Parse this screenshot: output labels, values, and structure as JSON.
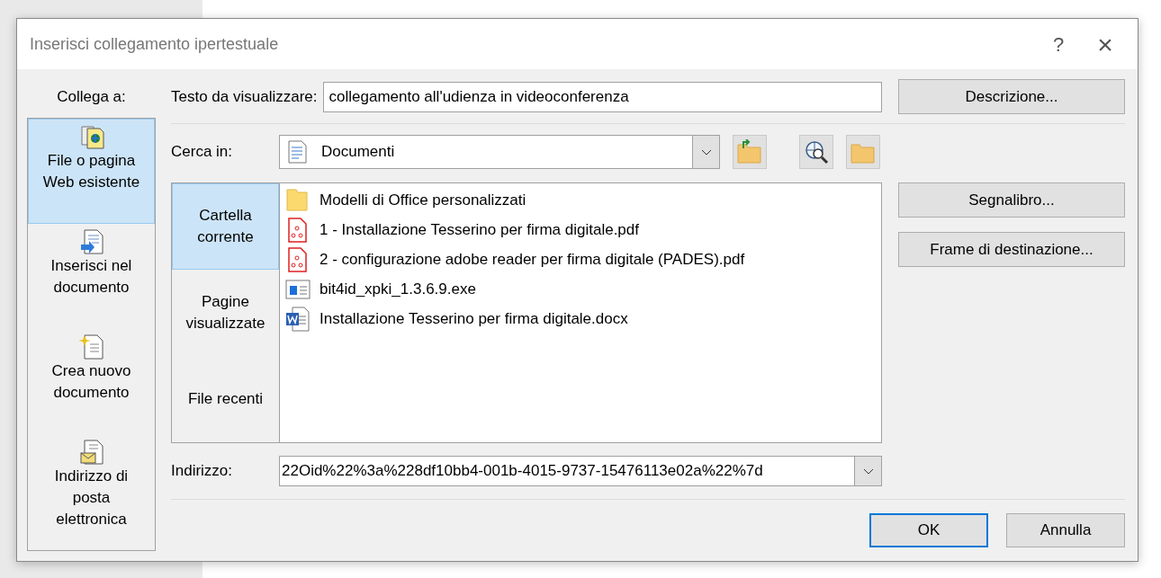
{
  "window": {
    "title": "Inserisci collegamento ipertestuale",
    "help": "?",
    "close": "×"
  },
  "sidebar": {
    "heading": "Collega a:",
    "items": [
      {
        "label": "File o pagina Web esistente",
        "kind": "file",
        "selected": true
      },
      {
        "label": "Inserisci nel documento",
        "kind": "place",
        "selected": false
      },
      {
        "label": "Crea nuovo documento",
        "kind": "new",
        "selected": false
      },
      {
        "label": "Indirizzo di posta elettronica",
        "kind": "email",
        "selected": false
      }
    ]
  },
  "display_text": {
    "label": "Testo da visualizzare:",
    "value": "collegamento all'udienza in videoconferenza"
  },
  "look_in": {
    "label": "Cerca in:",
    "value": "Documenti"
  },
  "nav": [
    {
      "label": "Cartella corrente",
      "selected": true
    },
    {
      "label": "Pagine visualizzate",
      "selected": false
    },
    {
      "label": "File recenti",
      "selected": false
    }
  ],
  "files": [
    {
      "name": "Modelli di Office personalizzati",
      "kind": "folder"
    },
    {
      "name": "1 - Installazione Tesserino per firma digitale.pdf",
      "kind": "pdf"
    },
    {
      "name": "2 - configurazione adobe reader per firma digitale (PADES).pdf",
      "kind": "pdf"
    },
    {
      "name": "bit4id_xpki_1.3.6.9.exe",
      "kind": "exe"
    },
    {
      "name": "Installazione Tesserino per firma digitale.docx",
      "kind": "docx"
    }
  ],
  "address": {
    "label": "Indirizzo:",
    "value": "22Oid%22%3a%228df10bb4-001b-4015-9737-15476113e02a%22%7d"
  },
  "side_buttons": [
    "Descrizione...",
    "Segnalibro...",
    "Frame di destinazione..."
  ],
  "buttons": [
    {
      "label": "OK",
      "default": true
    },
    {
      "label": "Annulla",
      "default": false
    }
  ]
}
